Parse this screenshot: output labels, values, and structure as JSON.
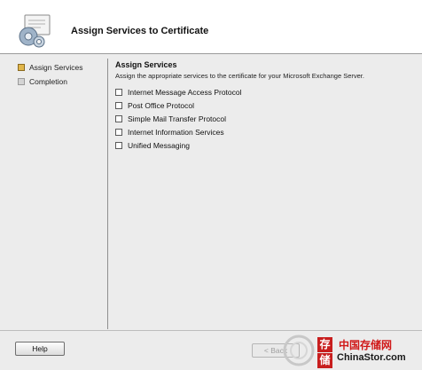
{
  "header": {
    "title": "Assign Services to Certificate",
    "icon": "certificate-gear-icon"
  },
  "steps": [
    {
      "label": "Assign Services",
      "state": "current"
    },
    {
      "label": "Completion",
      "state": "pending"
    }
  ],
  "main": {
    "section_title": "Assign Services",
    "description": "Assign the appropriate services to the certificate for your Microsoft Exchange Server.",
    "services": [
      {
        "label": "Internet Message Access Protocol",
        "checked": false
      },
      {
        "label": "Post Office Protocol",
        "checked": false
      },
      {
        "label": "Simple Mail Transfer Protocol",
        "checked": false
      },
      {
        "label": "Internet Information Services",
        "checked": false
      },
      {
        "label": "Unified Messaging",
        "checked": false
      }
    ]
  },
  "footer": {
    "help_label": "Help",
    "back_label": "< Back"
  },
  "watermark": {
    "chars": [
      "存",
      "储"
    ],
    "cn_text": "中国存储网",
    "url_text": "ChinaStor.com"
  },
  "colors": {
    "current_step": "#e1b64a",
    "watermark_red": "#d01818"
  }
}
